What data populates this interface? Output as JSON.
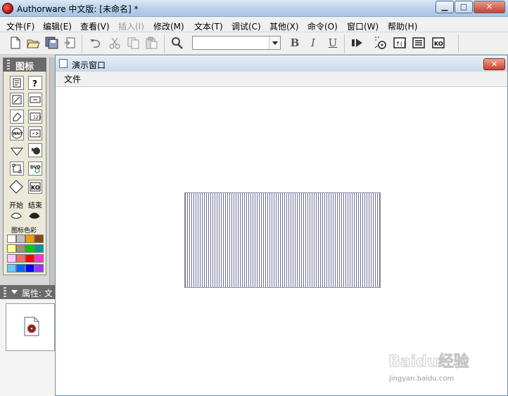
{
  "window": {
    "title": "Authorware 中文版: [未命名] *",
    "controls": {
      "minimize": "▁",
      "maximize": "□",
      "close": "✕"
    }
  },
  "menu": [
    {
      "label": "文件(F)",
      "enabled": true
    },
    {
      "label": "编辑(E)",
      "enabled": true
    },
    {
      "label": "查看(V)",
      "enabled": true
    },
    {
      "label": "插入(I)",
      "enabled": false
    },
    {
      "label": "修改(M)",
      "enabled": true
    },
    {
      "label": "文本(T)",
      "enabled": true
    },
    {
      "label": "调试(C)",
      "enabled": true
    },
    {
      "label": "其他(X)",
      "enabled": true
    },
    {
      "label": "命令(O)",
      "enabled": true
    },
    {
      "label": "窗口(W)",
      "enabled": true
    },
    {
      "label": "帮助(H)",
      "enabled": true
    }
  ],
  "toolbar": {
    "font_select_value": "",
    "bold": "B",
    "italic": "I",
    "underline": "U",
    "icons": [
      "new-icon",
      "open-icon",
      "save-all-icon",
      "import-icon",
      "undo-icon",
      "cut-icon",
      "copy-icon",
      "paste-icon",
      "find-icon",
      "run-icon",
      "control-panel-icon",
      "functions-icon",
      "variables-icon",
      "knowledge-objects-icon"
    ]
  },
  "palette": {
    "title": "图标",
    "start_label": "开始",
    "end_label": "结束",
    "color_label": "图标色彩",
    "icons": [
      "display-icon",
      "interaction-icon",
      "calculation-icon",
      "navigate-icon",
      "erase-icon",
      "framework-icon",
      "wait-icon",
      "decision-icon",
      "motion-icon",
      "digital-movie-icon",
      "map-icon",
      "dvd-icon",
      "sound-icon",
      "knowledge-object-icon"
    ],
    "swatches": [
      "#ffffff",
      "#c0c0c0",
      "#ff9900",
      "#8b4513",
      "#ffff99",
      "#999966",
      "#00cc00",
      "#009999",
      "#ffccff",
      "#ff6666",
      "#ff0000",
      "#ff33cc",
      "#66ccff",
      "#0066ff",
      "#0000ff",
      "#9933ff"
    ]
  },
  "properties": {
    "title": "属性: 文"
  },
  "presentation": {
    "title": "演示窗口",
    "menu_file": "文件",
    "close": "✕"
  },
  "watermark": {
    "logo": "Baidu经验",
    "url": "jingyan.baidu.com"
  }
}
